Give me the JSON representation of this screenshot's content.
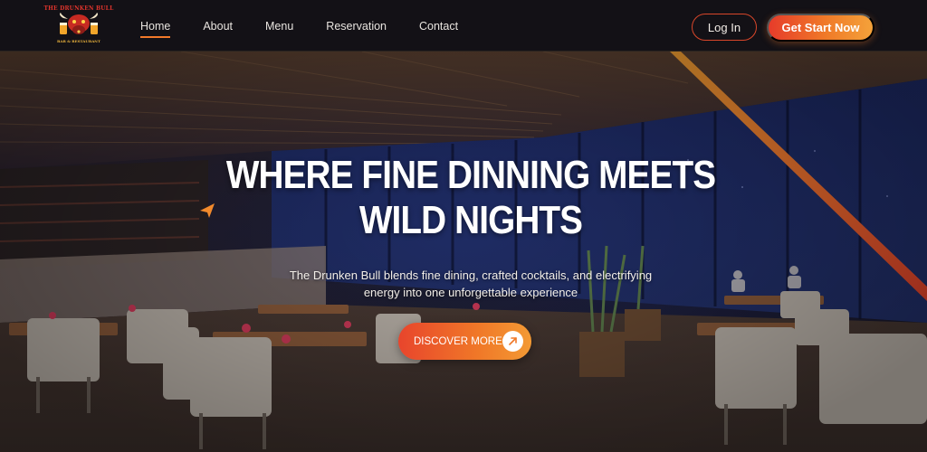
{
  "brand": {
    "logo_top_text": "THE DRUNKEN BULL",
    "logo_bottom_text": "BAR & RESTAURANT"
  },
  "nav": {
    "items": [
      {
        "label": "Home",
        "active": true
      },
      {
        "label": "About"
      },
      {
        "label": "Menu"
      },
      {
        "label": "Reservation"
      },
      {
        "label": "Contact"
      }
    ]
  },
  "header_actions": {
    "login_label": "Log In",
    "start_label": "Get Start Now"
  },
  "hero": {
    "title_line1": "WHERE FINE DINNING MEETS",
    "title_line2": "WILD NIGHTS",
    "subtitle_line1": "The Drunken Bull blends fine dining, crafted cocktails, and electrifying",
    "subtitle_line2": "energy into one unforgettable experience",
    "cta_label": "DISCOVER MORE",
    "cta_icon": "arrow-up-right-icon"
  },
  "colors": {
    "accent": "#f07828",
    "accent_red": "#e63b2a",
    "header_bg": "#131116",
    "text": "#ffffff"
  }
}
